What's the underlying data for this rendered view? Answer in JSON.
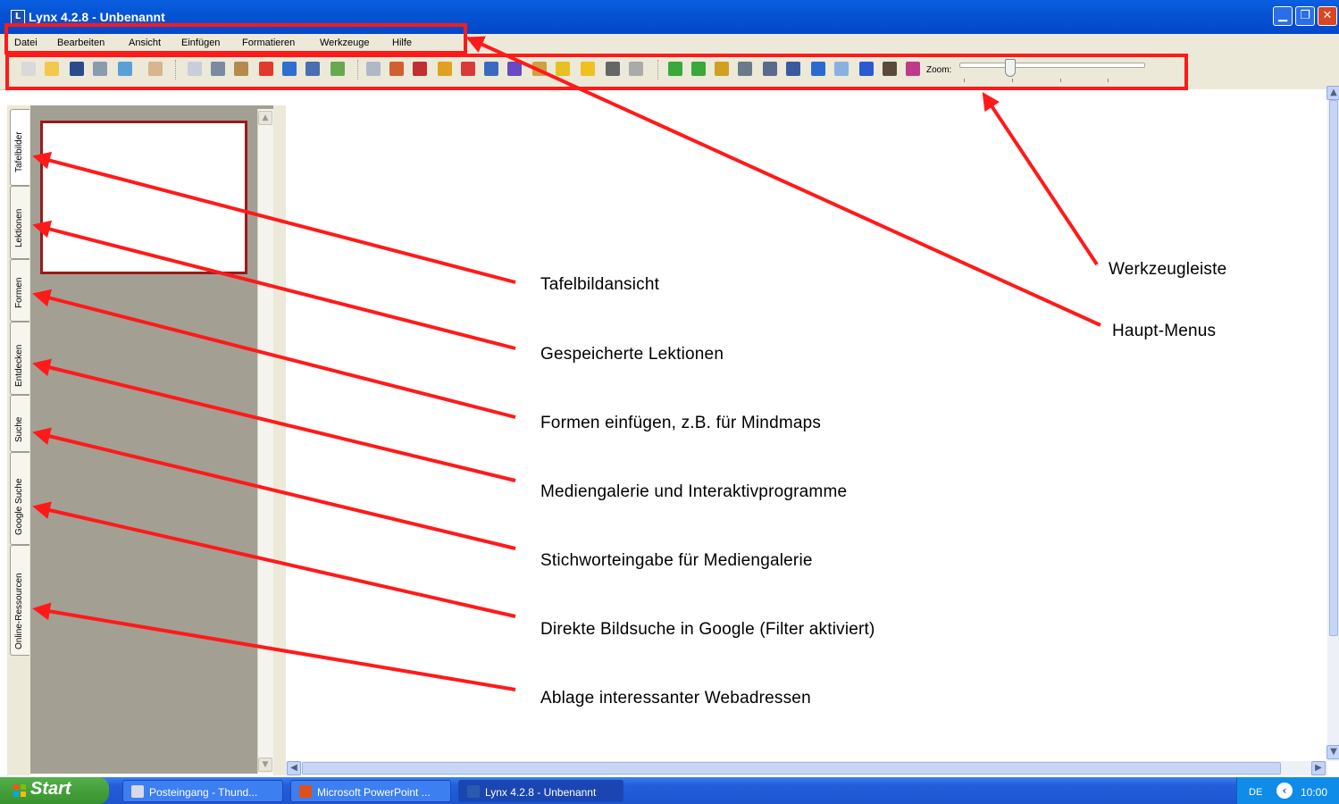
{
  "window": {
    "title": "Lynx 4.2.8 - Unbenannt",
    "minimize_glyph": "▁",
    "maximize_glyph": "❐",
    "close_glyph": "✕"
  },
  "menu": {
    "items": [
      "Datei",
      "Bearbeiten",
      "Ansicht",
      "Einfügen",
      "Formatieren",
      "Werkzeuge",
      "Hilfe"
    ]
  },
  "toolbar": {
    "zoom_label": "Zoom:",
    "zoom_level": 0.27,
    "icons": [
      {
        "name": "new-icon",
        "color": "#d9d9d9"
      },
      {
        "name": "open-icon",
        "color": "#f2c94c"
      },
      {
        "name": "save-icon",
        "color": "#2a4a8c"
      },
      {
        "name": "print-icon",
        "color": "#8a9bb0"
      },
      {
        "name": "export-icon",
        "color": "#5aa0d8"
      },
      {
        "name": "hand-icon",
        "color": "#d8b58c"
      },
      {
        "name": "copy-icon",
        "color": "#c9cdd8"
      },
      {
        "name": "cut-icon",
        "color": "#7a8aa0"
      },
      {
        "name": "paste-icon",
        "color": "#b58a4c"
      },
      {
        "name": "delete-icon",
        "color": "#e03a2a"
      },
      {
        "name": "undo-icon",
        "color": "#2f6fd0"
      },
      {
        "name": "redo-icon",
        "color": "#4a6fb0"
      },
      {
        "name": "insert-image-icon",
        "color": "#6aa84f"
      },
      {
        "name": "select-arrow-icon",
        "color": "#b0b8c8"
      },
      {
        "name": "pen-icon",
        "color": "#d06030"
      },
      {
        "name": "text-icon",
        "color": "#c03030"
      },
      {
        "name": "pencil-icon",
        "color": "#e0a020"
      },
      {
        "name": "shapes-icon",
        "color": "#d83a3a"
      },
      {
        "name": "line-icon",
        "color": "#3a6ac0"
      },
      {
        "name": "fill-icon",
        "color": "#6a4ac0"
      },
      {
        "name": "eraser-icon",
        "color": "#d0a040"
      },
      {
        "name": "highlighter-icon",
        "color": "#e8c020"
      },
      {
        "name": "marker-icon",
        "color": "#f0c020"
      },
      {
        "name": "crop-icon",
        "color": "#666666"
      },
      {
        "name": "lasso-icon",
        "color": "#aaaaaa"
      },
      {
        "name": "back-icon",
        "color": "#3aa83a"
      },
      {
        "name": "forward-icon",
        "color": "#3aa83a"
      },
      {
        "name": "ruler-icon",
        "color": "#d0a020"
      },
      {
        "name": "compass-icon",
        "color": "#6a7a8a"
      },
      {
        "name": "screen-shade-icon",
        "color": "#5a6a8a"
      },
      {
        "name": "blank-page-icon",
        "color": "#3a5aa0"
      },
      {
        "name": "globe-icon",
        "color": "#2a6ad0"
      },
      {
        "name": "spotlight-icon",
        "color": "#8ab0e0"
      },
      {
        "name": "next-icon",
        "color": "#2a5ad0"
      },
      {
        "name": "camera-icon",
        "color": "#5a4a3a"
      },
      {
        "name": "grid-icon",
        "color": "#c03a8a"
      }
    ]
  },
  "sidebar": {
    "tabs": [
      "Tafelbilder",
      "Lektionen",
      "Formen",
      "Entdecken",
      "Suche",
      "Google Suche",
      "Online-Ressourcen"
    ],
    "active_tab": "Tafelbilder"
  },
  "annotations": {
    "left": [
      "Tafelbildansicht",
      "Gespeicherte Lektionen",
      "Formen einfügen, z.B. für Mindmaps",
      "Mediengalerie und Interaktivprogramme",
      "Stichworteingabe für Mediengalerie",
      "Direkte Bildsuche in Google (Filter aktiviert)",
      "Ablage interessanter Webadressen"
    ],
    "right": [
      "Werkzeugleiste",
      "Haupt-Menus"
    ],
    "arrow_color": "#ff1a1a"
  },
  "taskbar": {
    "start_label": "Start",
    "tasks": [
      {
        "label": "Posteingang - Thund...",
        "icon": "thunderbird-icon",
        "color": "#d8d8e8"
      },
      {
        "label": "Microsoft PowerPoint ...",
        "icon": "powerpoint-icon",
        "color": "#e0501a"
      },
      {
        "label": "Lynx 4.2.8 - Unbenannt",
        "icon": "lynx-icon",
        "color": "#2a5ab0"
      }
    ],
    "lang": "DE",
    "clock": "10:00"
  }
}
